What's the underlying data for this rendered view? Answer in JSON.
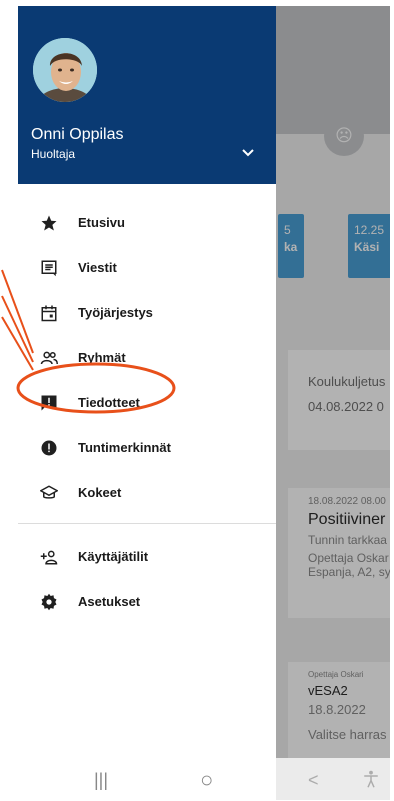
{
  "user": {
    "name": "Onni Oppilas",
    "role": "Huoltaja"
  },
  "menu": {
    "items": [
      {
        "label": "Etusivu",
        "icon": "star-icon"
      },
      {
        "label": "Viestit",
        "icon": "message-icon"
      },
      {
        "label": "Työjärjestys",
        "icon": "calendar-icon"
      },
      {
        "label": "Ryhmät",
        "icon": "group-icon"
      },
      {
        "label": "Tiedotteet",
        "icon": "announcement-icon"
      },
      {
        "label": "Tuntimerkinnät",
        "icon": "alert-icon"
      },
      {
        "label": "Kokeet",
        "icon": "school-icon"
      }
    ],
    "secondary": [
      {
        "label": "Käyttäjätilit",
        "icon": "add-person-icon"
      },
      {
        "label": "Asetukset",
        "icon": "gear-icon"
      }
    ]
  },
  "background": {
    "tiles": [
      {
        "line1": "5",
        "line2": "ka"
      },
      {
        "line1": "12.25",
        "line2": "Käsi"
      }
    ],
    "card1": {
      "title": "Koulukuljetus",
      "date": "04.08.2022 0"
    },
    "card2": {
      "meta": "18.08.2022 08.00",
      "title": "Positiiviner",
      "line1": "Tunnin tarkkaa",
      "line2": "Opettaja Oskar",
      "line3": "Espanja, A2, sy"
    },
    "card3": {
      "meta": "Opettaja Oskari",
      "title": "vESA2",
      "date": "18.8.2022",
      "line1": "Valitse harras"
    }
  },
  "nav": {
    "recents": "|||",
    "home": "○",
    "back": "<",
    "accessibility": "accessibility-icon"
  },
  "colors": {
    "header": "#0a3a73",
    "annotation": "#e8501a",
    "tile": "#4a9fd6"
  }
}
